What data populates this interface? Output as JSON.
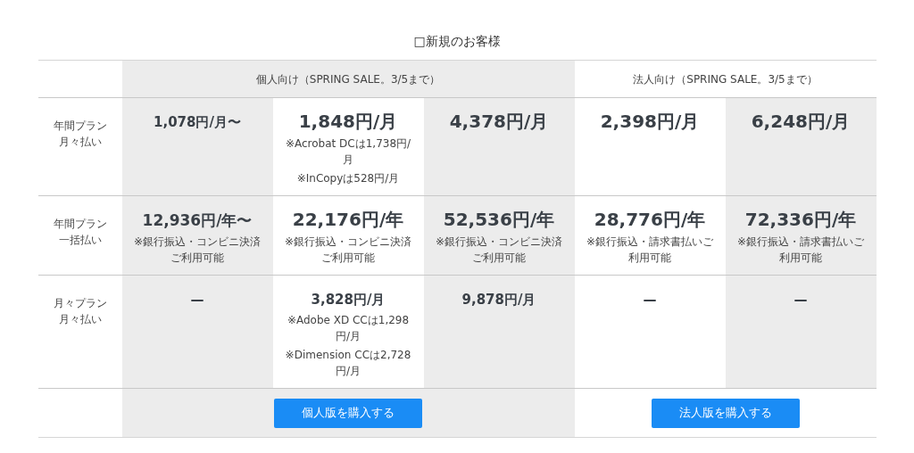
{
  "title": "□新規のお客様",
  "groups": [
    {
      "label": "個人向け（SPRING SALE。3/5まで）"
    },
    {
      "label": "法人向け（SPRING SALE。3/5まで）"
    }
  ],
  "rows": [
    {
      "label_lines": [
        "年間プラン",
        "月々払い"
      ],
      "cells": [
        {
          "price": "1,078円/月〜"
        },
        {
          "price": "1,848円/月",
          "notes": [
            "※Acrobat DCは1,738円/月",
            "※InCopyは528円/月"
          ]
        },
        {
          "price": "4,378円/月"
        },
        {
          "price": "2,398円/月"
        },
        {
          "price": "6,248円/月"
        }
      ]
    },
    {
      "label_lines": [
        "年間プラン",
        "一括払い"
      ],
      "cells": [
        {
          "price": "12,936円/年〜",
          "notes": [
            "※銀行振込・コンビニ決済ご利用可能"
          ]
        },
        {
          "price": "22,176円/年",
          "notes": [
            "※銀行振込・コンビニ決済ご利用可能"
          ]
        },
        {
          "price": "52,536円/年",
          "notes": [
            "※銀行振込・コンビニ決済ご利用可能"
          ]
        },
        {
          "price": "28,776円/年",
          "notes": [
            "※銀行振込・請求書払いご利用可能"
          ]
        },
        {
          "price": "72,336円/年",
          "notes": [
            "※銀行振込・請求書払いご利用可能"
          ]
        }
      ]
    },
    {
      "label_lines": [
        "月々プラン",
        "月々払い"
      ],
      "cells": [
        {
          "price": "—"
        },
        {
          "price": "3,828円/月",
          "notes": [
            "※Adobe XD CCは1,298円/月",
            "※Dimension CCは2,728円/月"
          ]
        },
        {
          "price": "9,878円/月"
        },
        {
          "price": "—"
        },
        {
          "price": "—"
        }
      ]
    }
  ],
  "buttons": [
    {
      "label": "個人版を購入する"
    },
    {
      "label": "法人版を購入する"
    }
  ]
}
